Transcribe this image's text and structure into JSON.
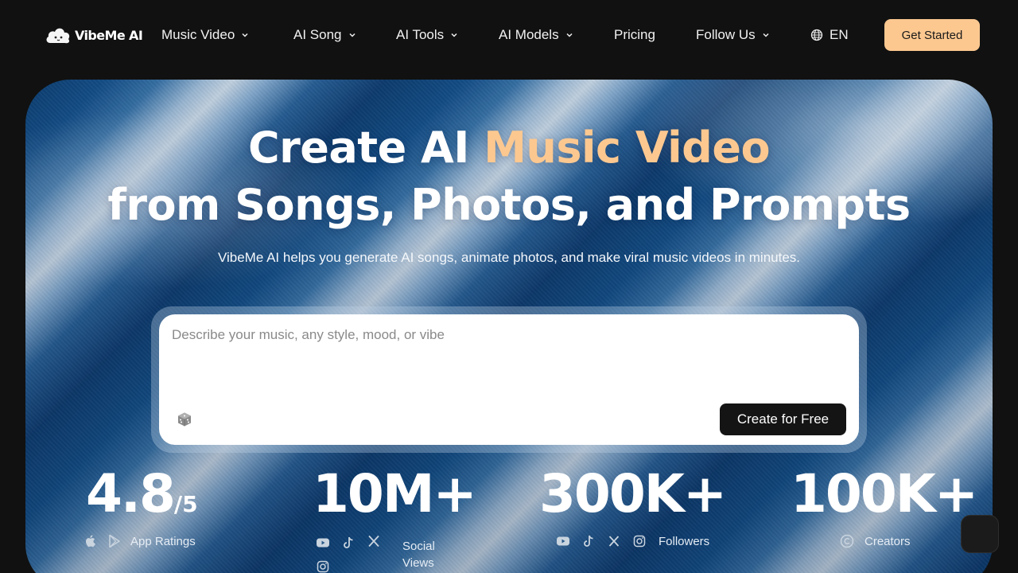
{
  "brand": {
    "name": "VibeMe AI"
  },
  "nav": {
    "items": [
      {
        "label": "Music Video",
        "dropdown": true
      },
      {
        "label": "AI Song",
        "dropdown": true
      },
      {
        "label": "AI Tools",
        "dropdown": true
      },
      {
        "label": "AI Models",
        "dropdown": true
      },
      {
        "label": "Pricing",
        "dropdown": false
      },
      {
        "label": "Follow Us",
        "dropdown": true
      }
    ],
    "language": "EN",
    "cta_label": "Get Started"
  },
  "hero": {
    "title_line1_white": "Create AI ",
    "title_line1_accent": "Music Video",
    "title_line2": "from Songs, Photos, and Prompts",
    "subtitle": "VibeMe AI helps you generate AI songs, animate photos, and make viral music videos in minutes.",
    "prompt": {
      "placeholder": "Describe your music, any style, mood, or vibe",
      "value": "",
      "create_label": "Create for Free"
    }
  },
  "stats": [
    {
      "value": "4.8",
      "suffix": "/5",
      "label": "App Ratings",
      "icons": [
        "apple-icon",
        "google-play-icon"
      ]
    },
    {
      "value": "10M+",
      "suffix": "",
      "label_line1": "Social",
      "label_line2": "Views",
      "icons": [
        "youtube-icon",
        "tiktok-icon",
        "x-icon",
        "instagram-icon"
      ]
    },
    {
      "value": "300K+",
      "suffix": "",
      "label": "Followers",
      "icons": [
        "youtube-icon",
        "tiktok-icon",
        "x-icon",
        "instagram-icon"
      ]
    },
    {
      "value": "100K+",
      "suffix": "",
      "label": "Creators",
      "icons": [
        "copyright-icon"
      ]
    }
  ],
  "colors": {
    "accent": "#fcc890",
    "background": "#111111",
    "cta_text": "#1a1a1a"
  }
}
